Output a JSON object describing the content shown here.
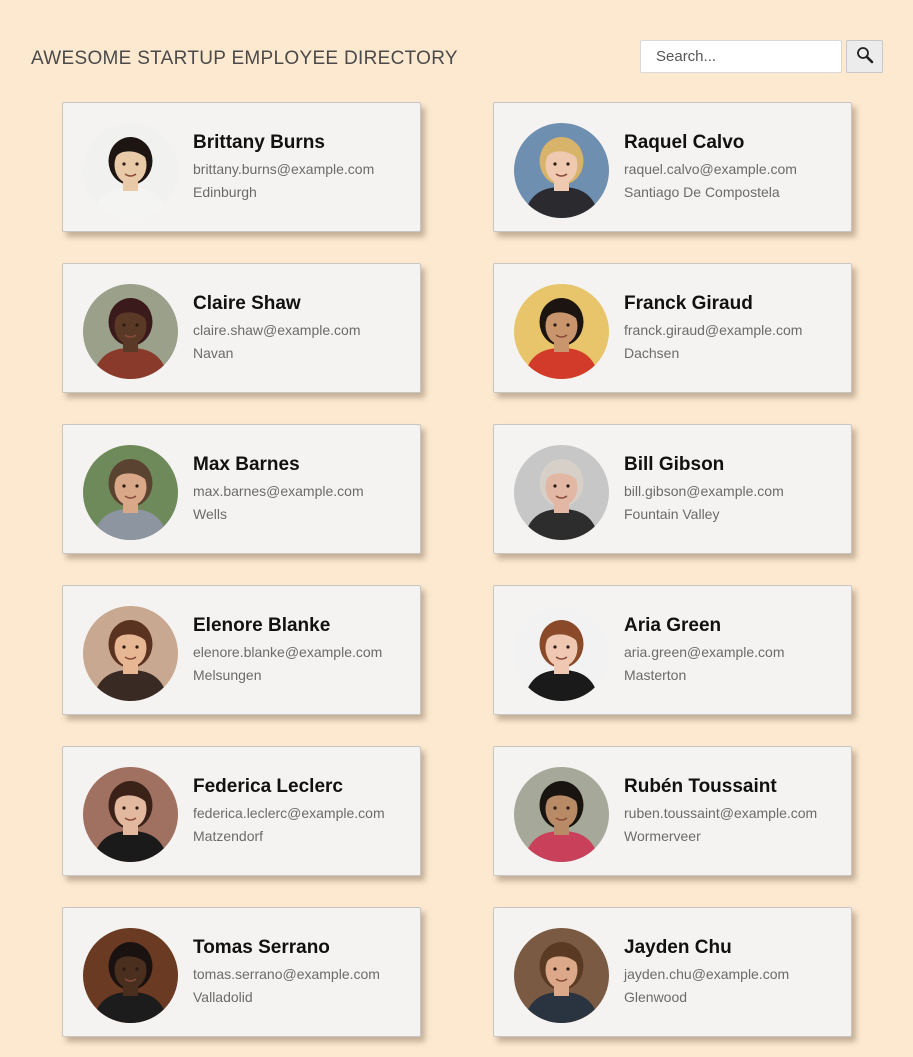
{
  "header": {
    "title": "AWESOME STARTUP EMPLOYEE DIRECTORY"
  },
  "search": {
    "placeholder": "Search...",
    "button_icon": "search-icon"
  },
  "employees": [
    {
      "name": "Brittany Burns",
      "email": "brittany.burns@example.com",
      "location": "Edinburgh",
      "skin": "#e8c9a8",
      "hair": "#1c1512",
      "bg": "#f1f1ef",
      "shirt": "#f4f4f2"
    },
    {
      "name": "Raquel Calvo",
      "email": "raquel.calvo@example.com",
      "location": "Santiago De Compostela",
      "skin": "#efc9b0",
      "hair": "#d8b36a",
      "bg": "#6f8fb0",
      "shirt": "#2b2b2f"
    },
    {
      "name": "Claire Shaw",
      "email": "claire.shaw@example.com",
      "location": "Navan",
      "skin": "#5a3a26",
      "hair": "#3a1a1a",
      "bg": "#9aa089",
      "shirt": "#8a3a2a"
    },
    {
      "name": "Franck Giraud",
      "email": "franck.giraud@example.com",
      "location": "Dachsen",
      "skin": "#c9956c",
      "hair": "#1c1410",
      "bg": "#e8c46a",
      "shirt": "#d23b2a"
    },
    {
      "name": "Max Barnes",
      "email": "max.barnes@example.com",
      "location": "Wells",
      "skin": "#d8a888",
      "hair": "#5a4330",
      "bg": "#6f8a5a",
      "shirt": "#8c95a0"
    },
    {
      "name": "Bill Gibson",
      "email": "bill.gibson@example.com",
      "location": "Fountain Valley",
      "skin": "#e2b8a4",
      "hair": "#d6d0c8",
      "bg": "#c7c7c7",
      "shirt": "#2d2d2d"
    },
    {
      "name": "Elenore Blanke",
      "email": "elenore.blanke@example.com",
      "location": "Melsungen",
      "skin": "#e7b692",
      "hair": "#5a3220",
      "bg": "#c8a890",
      "shirt": "#3a2a24"
    },
    {
      "name": "Aria Green",
      "email": "aria.green@example.com",
      "location": "Masterton",
      "skin": "#f0c8b2",
      "hair": "#8a4a2a",
      "bg": "#f2f2f2",
      "shirt": "#1a1a1a"
    },
    {
      "name": "Federica Leclerc",
      "email": "federica.leclerc@example.com",
      "location": "Matzendorf",
      "skin": "#e2b89e",
      "hair": "#3a2218",
      "bg": "#a07060",
      "shirt": "#1a1a1a"
    },
    {
      "name": "Rubén Toussaint",
      "email": "ruben.toussaint@example.com",
      "location": "Wormerveer",
      "skin": "#b98a66",
      "hair": "#1a1410",
      "bg": "#a6a89a",
      "shirt": "#c8405a"
    },
    {
      "name": "Tomas Serrano",
      "email": "tomas.serrano@example.com",
      "location": "Valladolid",
      "skin": "#4a2e1e",
      "hair": "#1a1210",
      "bg": "#6a3a22",
      "shirt": "#1c1c1c"
    },
    {
      "name": "Jayden Chu",
      "email": "jayden.chu@example.com",
      "location": "Glenwood",
      "skin": "#dca88a",
      "hair": "#5a3a22",
      "bg": "#7a5a42",
      "shirt": "#2a3440"
    }
  ]
}
